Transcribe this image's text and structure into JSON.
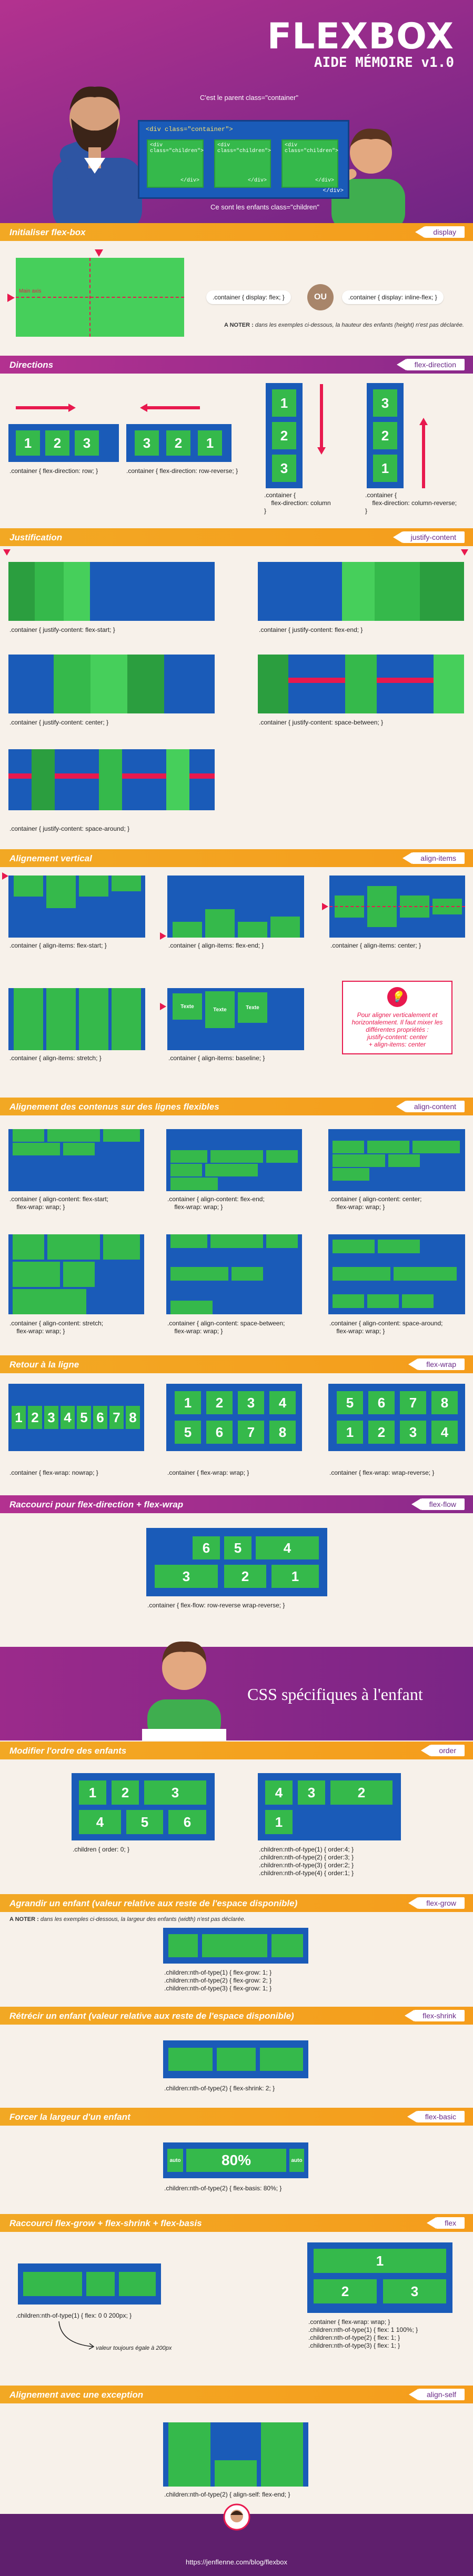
{
  "hero": {
    "title": "FLEXBOX",
    "subtitle": "AIDE MÉMOIRE v1.0",
    "bubble_parent": "C'est le parent class=\"container\"",
    "bubble_children": "Ce sont les enfants class=\"children\"",
    "code_open": "<div class=\"container\">",
    "child_open": "<div class=\"children\">",
    "child_close": "</div>",
    "code_close": "</div>"
  },
  "sections": {
    "init": {
      "title": "Initialiser flex-box",
      "prop": "display"
    },
    "directions": {
      "title": "Directions",
      "prop": "flex-direction"
    },
    "justify": {
      "title": "Justification",
      "prop": "justify-content"
    },
    "align_items": {
      "title": "Alignement vertical",
      "prop": "align-items"
    },
    "align_content": {
      "title": "Alignement des contenus sur des lignes flexibles",
      "prop": "align-content"
    },
    "wrap": {
      "title": "Retour à la ligne",
      "prop": "flex-wrap"
    },
    "flow": {
      "title": "Raccourci pour flex-direction + flex-wrap",
      "prop": "flex-flow"
    },
    "order": {
      "title": "Modifier l'ordre des enfants",
      "prop": "order"
    },
    "grow": {
      "title": "Agrandir un enfant (valeur relative aux reste de l'espace disponible)",
      "prop": "flex-grow"
    },
    "shrink": {
      "title": "Rétrécir un enfant (valeur relative aux reste de l'espace disponible)",
      "prop": "flex-shrink"
    },
    "basis": {
      "title": "Forcer la largeur d'un enfant",
      "prop": "flex-basic"
    },
    "flex": {
      "title": "Raccourci flex-grow + flex-shrink + flex-basis",
      "prop": "flex"
    },
    "self": {
      "title": "Alignement avec une exception",
      "prop": "align-self"
    }
  },
  "init": {
    "flex_label": ".container { display: flex; }",
    "ou": "OU",
    "inline_label": ".container { display: inline-flex; }",
    "note_bold": "A NOTER :",
    "note": "dans les exemples ci-dessous, la hauteur des enfants (height) n'est pas déclarée.",
    "axis_label": "Main axis"
  },
  "directions": {
    "row": ".container { flex-direction: row; }",
    "row_reverse": ".container { flex-direction: row-reverse; }",
    "column": ".container {\n    flex-direction: column\n}",
    "column_reverse": ".container {\n    flex-direction: column-reverse;\n}",
    "n1": "1",
    "n2": "2",
    "n3": "3"
  },
  "justify": {
    "start": ".container { justify-content: flex-start; }",
    "end": ".container { justify-content: flex-end; }",
    "center": ".container { justify-content: center; }",
    "between": ".container { justify-content: space-between; }",
    "around": ".container { justify-content: space-around; }"
  },
  "align_items": {
    "start": ".container { align-items: flex-start; }",
    "end": ".container { align-items: flex-end; }",
    "center": ".container { align-items: center; }",
    "stretch": ".container { align-items: stretch; }",
    "baseline": ".container { align-items: baseline; }",
    "word": "Texte",
    "tip": "Pour aligner verticalement et horizontalement. Il faut mixer les différentes propriétés :\njustify-content: center\n+ align-items: center"
  },
  "align_content": {
    "start": ".container { align-content: flex-start;\n    flex-wrap: wrap; }",
    "end": ".container { align-content: flex-end;\n    flex-wrap: wrap; }",
    "center": ".container { align-content: center;\n    flex-wrap: wrap; }",
    "stretch": ".container { align-content: stretch;\n    flex-wrap: wrap; }",
    "between": ".container { align-content: space-between;\n    flex-wrap: wrap; }",
    "around": ".container { align-content: space-around;\n    flex-wrap: wrap; }"
  },
  "wrap": {
    "nowrap": ".container { flex-wrap: nowrap; }",
    "wrap": ".container { flex-wrap: wrap; }",
    "wrap_reverse": ".container { flex-wrap: wrap-reverse; }",
    "nums": [
      "1",
      "2",
      "3",
      "4",
      "5",
      "6",
      "7",
      "8"
    ]
  },
  "flow": {
    "label": ".container { flex-flow: row-reverse wrap-reverse; }",
    "nums": [
      "6",
      "5",
      "4",
      "3",
      "2",
      "1"
    ]
  },
  "enfant": {
    "title": "CSS spécifiques à l'enfant"
  },
  "order": {
    "label1": ".children { order: 0; }",
    "label2": ".children:nth-of-type(1) { order:4; }\n.children:nth-of-type(2) { order:3; }\n.children:nth-of-type(3) { order:2; }\n.children:nth-of-type(4) { order:1; }",
    "nums_a": [
      "1",
      "2",
      "3",
      "4",
      "5",
      "6"
    ],
    "nums_b": [
      "4",
      "3",
      "2",
      "1"
    ]
  },
  "grow": {
    "note_bold": "A NOTER :",
    "note": "dans les exemples ci-dessous, la largeur des enfants (width) n'est pas déclarée.",
    "label": ".children:nth-of-type(1) { flex-grow: 1; }\n.children:nth-of-type(2) { flex-grow: 2; }\n.children:nth-of-type(3) { flex-grow: 1; }"
  },
  "shrink": {
    "label": ".children:nth-of-type(2) { flex-shrink: 2; }"
  },
  "basis": {
    "label": ".children:nth-of-type(2) { flex-basis: 80%; }",
    "pct": "80%",
    "auto1": "auto",
    "auto2": "auto"
  },
  "flex": {
    "label1": ".children:nth-of-type(1) { flex: 0 0 200px; }",
    "value_note": "valeur toujours égale à 200px",
    "label2": ".container { flex-wrap: wrap; }\n.children:nth-of-type(1) { flex: 1 100%; }\n.children:nth-of-type(2) { flex: 1; }\n.children:nth-of-type(3) { flex: 1; }",
    "n1": "1",
    "n2": "2",
    "n3": "3"
  },
  "self": {
    "label": ".children:nth-of-type(2) { align-self: flex-end; }"
  },
  "footer": {
    "url": "https://jenflenne.com/blog/flexbox"
  },
  "colors": {
    "container": "#1a5bb8",
    "item": "#35b94b",
    "accent": "#f59d1c",
    "purple": "#8b2a8b",
    "marker": "#e8194e"
  }
}
